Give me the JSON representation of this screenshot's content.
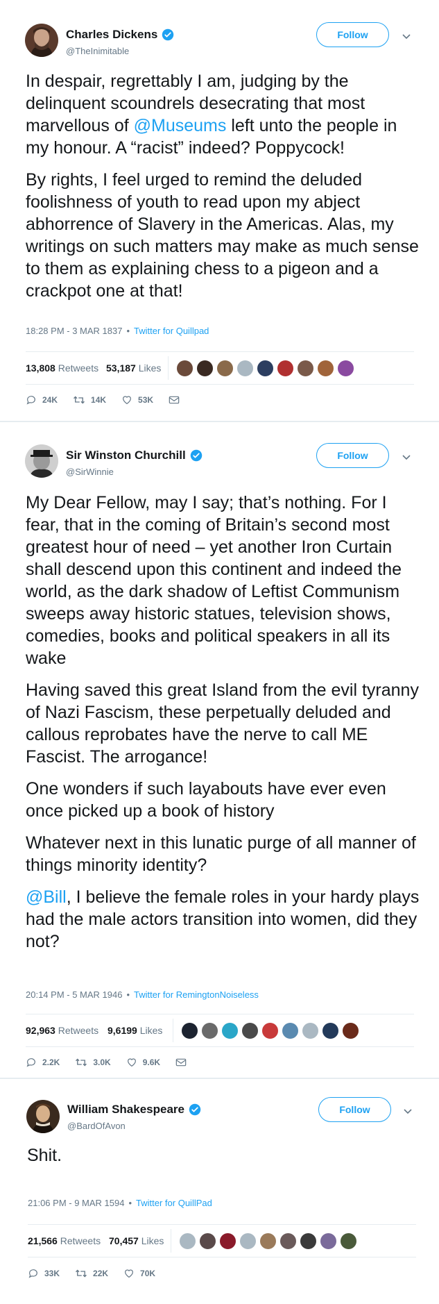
{
  "colors": {
    "accent": "#1da1f2",
    "muted": "#657786",
    "text": "#14171a",
    "divider": "#e6ecf0"
  },
  "tweets": [
    {
      "name": "Charles Dickens",
      "handle": "@TheInimitable",
      "follow_label": "Follow",
      "paragraphs": [
        {
          "pre": "In despair, regrettably I am, judging by the delinquent scoundrels desecrating that most marvellous of ",
          "mention": "@Museums",
          "post": " left unto the people in my honour. A “racist” indeed? Poppycock!"
        },
        {
          "pre": "By rights, I feel urged to remind the deluded foolishness of youth to read upon my abject abhorrence of Slavery in the Americas. Alas, my writings on such matters may make as much sense to them as explaining chess to a pigeon and a crackpot one at that!"
        }
      ],
      "timestamp": "18:28 PM - 3 MAR 1837",
      "dot": "•",
      "source": "Twitter for Quillpad",
      "retweets": "13,808",
      "retweets_label": "Retweets",
      "likes": "53,187",
      "likes_label": "Likes",
      "replies_count": "24K",
      "retweet_count": "14K",
      "like_count": "53K",
      "show_mail": true
    },
    {
      "name": "Sir Winston Churchill",
      "handle": "@SirWinnie",
      "follow_label": "Follow",
      "paragraphs": [
        {
          "pre": "My Dear Fellow, may I say; that’s nothing. For I fear, that in the coming of Britain’s second most greatest hour of need – yet another Iron Curtain shall descend upon this continent and indeed the world, as the dark shadow of Leftist Communism sweeps away historic statues, television shows, comedies, books and political speakers in all its wake"
        },
        {
          "pre": "Having saved this great Island from the evil tyranny of Nazi Fascism, these perpetually deluded and callous reprobates have the nerve to call ME Fascist. The arrogance!"
        },
        {
          "pre": "One wonders if such layabouts have ever even once picked up a book of history"
        },
        {
          "pre": "Whatever next in this lunatic purge of all manner of things minority identity?"
        },
        {
          "mention": "@Bill",
          "post": ", I believe the female roles in your hardy plays had the male actors transition into women, did they not?"
        }
      ],
      "timestamp": "20:14 PM - 5 MAR 1946",
      "dot": "•",
      "source": "Twitter for RemingtonNoiseless",
      "retweets": "92,963",
      "retweets_label": "Retweets",
      "likes": "9,6199",
      "likes_label": "Likes",
      "replies_count": "2.2K",
      "retweet_count": "3.0K",
      "like_count": "9.6K",
      "show_mail": true
    },
    {
      "name": "William Shakespeare",
      "handle": "@BardOfAvon",
      "follow_label": "Follow",
      "paragraphs": [
        {
          "pre": "Shit."
        }
      ],
      "timestamp": "21:06 PM - 9 MAR 1594",
      "dot": "•",
      "source": "Twitter for QuillPad",
      "retweets": "21,566",
      "retweets_label": "Retweets",
      "likes": "70,457",
      "likes_label": "Likes",
      "replies_count": "33K",
      "retweet_count": "22K",
      "like_count": "70K",
      "show_mail": false
    }
  ]
}
